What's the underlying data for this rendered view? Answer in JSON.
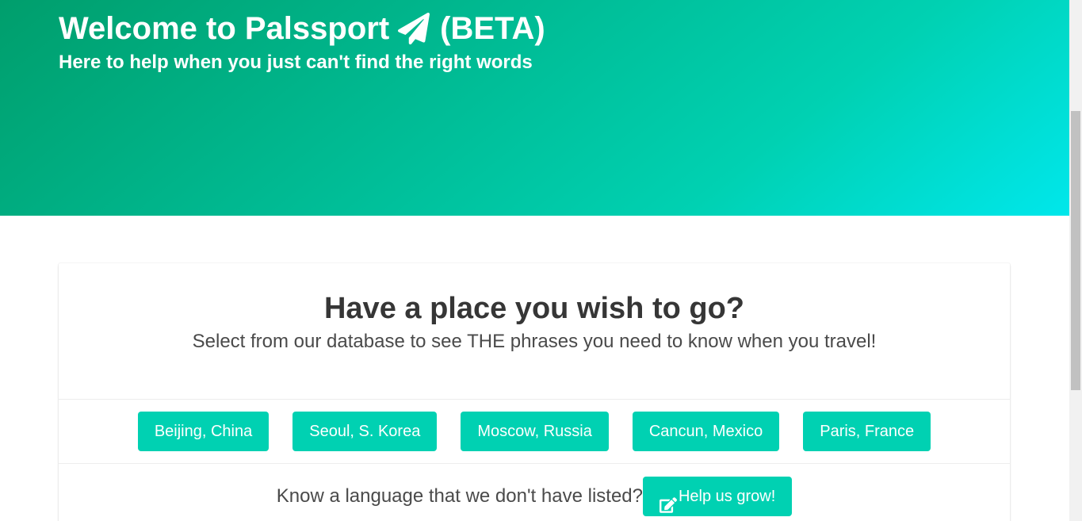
{
  "hero": {
    "title_prefix": "Welcome to Palssport",
    "title_suffix": "(BETA)",
    "title_icon": "paper-plane-icon",
    "subtitle": "Here to help when you just can't find the right words",
    "gradient_colors": [
      "#009e6c",
      "#00d1b2",
      "#00e7eb"
    ]
  },
  "card": {
    "title": "Have a place you wish to go?",
    "subtitle": "Select from our database to see THE phrases you need to know when you travel!",
    "cities": [
      {
        "label": "Beijing, China"
      },
      {
        "label": "Seoul, S. Korea"
      },
      {
        "label": "Moscow, Russia"
      },
      {
        "label": "Cancun, Mexico"
      },
      {
        "label": "Paris, France"
      }
    ],
    "language_prompt": "Know a language that we don't have listed?",
    "help_button": {
      "label": "Help us grow!",
      "icon": "edit-icon"
    }
  },
  "colors": {
    "primary": "#00d1b2",
    "text": "#363636"
  }
}
